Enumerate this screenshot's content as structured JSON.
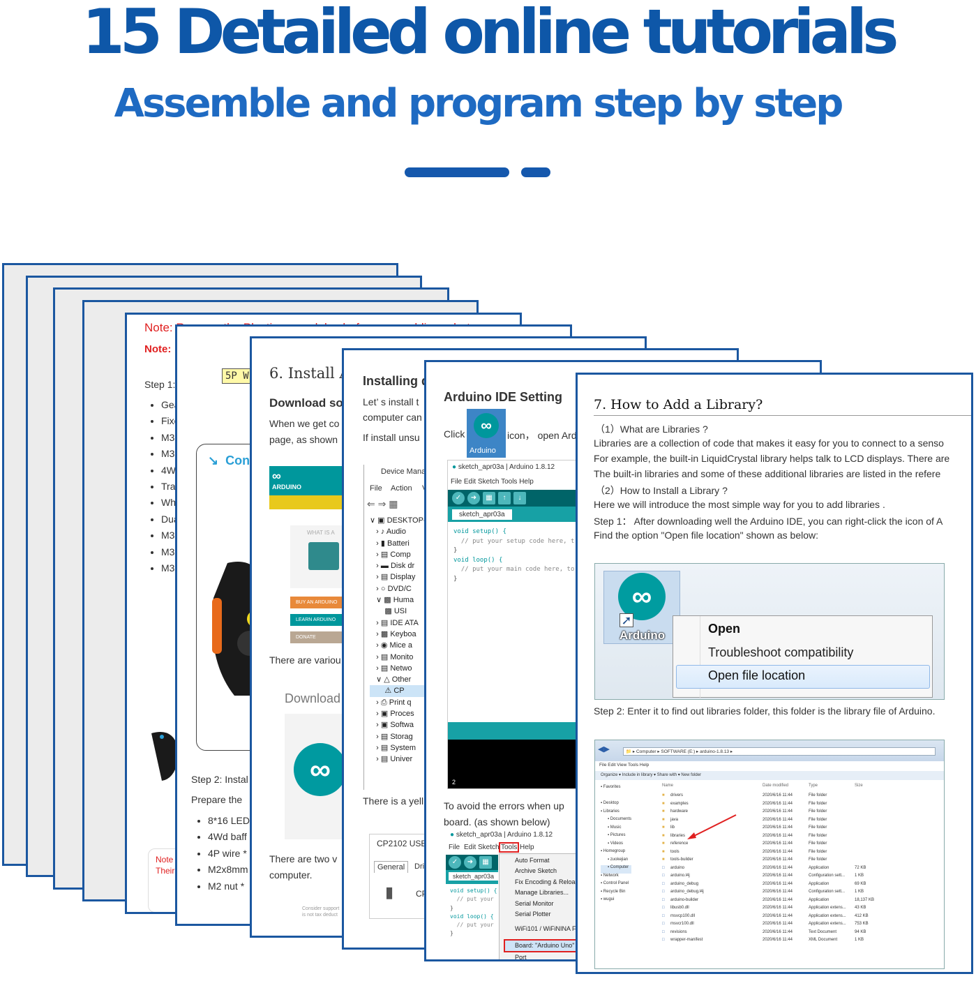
{
  "hero": {
    "title": "15 Detailed online tutorials",
    "subtitle": "Assemble and program step by step"
  },
  "pages": {
    "p1": {
      "note_red": "Note: Remove the Plastic ... modules before assembling robot ...",
      "note_label": "Note:",
      "step": "Step 1:",
      "items": [
        "Gea",
        "Fixe",
        "M3",
        "M3",
        "4W",
        "Trac",
        "Wh",
        "Dua",
        "M3",
        "M3",
        "M3"
      ],
      "bottom_note_1": "Note",
      "bottom_note_2": "Their"
    },
    "p2": {
      "label_5p": "5P Wi",
      "con": "Con",
      "step2": "Step 2: Instal",
      "prepare": "Prepare the",
      "items": [
        "8*16 LED",
        "4Wd baff",
        "4P wire *",
        "M2x8mm",
        "M2 nut *"
      ]
    },
    "p3": {
      "heading": "6. Install Ar",
      "subheading": "Download so",
      "line1": "When we get co",
      "line2": "page, as shown",
      "logo_text": "ARDUINO",
      "card_what": "WHAT IS A",
      "btn_buy": "BUY AN ARDUINO",
      "btn_learn": "LEARN ARDUINO",
      "btn_donate": "DONATE",
      "various": "There are variou",
      "download": "Download",
      "two": "There are two v",
      "computer": "computer.",
      "footer_1": "Consider support",
      "footer_2": "is not tax deduct"
    },
    "p4": {
      "heading": "Installing d",
      "line1": "Let’ s install t",
      "line2": "computer can",
      "line3": "If install unsu",
      "dm_title": "Device Mana",
      "dm_menu": [
        "File",
        "Action",
        "V"
      ],
      "tree": [
        "DESKTOP-",
        "Audio",
        "Batteri",
        "Comp",
        "Disk dr",
        "Display",
        "DVD/C",
        "Huma",
        "USI",
        "IDE ATA",
        "Keyboa",
        "Mice a",
        "Monito",
        "Netwo",
        "Other",
        "CP",
        "Print q",
        "Proces",
        "Softwa",
        "Storag",
        "System",
        "Univer"
      ],
      "yellow": "There is a yell",
      "cp_title": "CP2102 USB t",
      "tab_general": "General",
      "tab_driver": "Driv",
      "cp_short": "CP"
    },
    "p5": {
      "heading": "Arduino IDE Setting",
      "click": "Click",
      "icon_text": "icon， open Ard",
      "icon_label": "Arduino",
      "ide_title": "sketch_apr03a | Arduino 1.8.12",
      "ide_menu": "File  Edit  Sketch  Tools  Help",
      "tab": "sketch_apr03a",
      "code": [
        "void setup() {",
        "  // put your setup code here, t",
        "",
        "}",
        "",
        "void loop() {",
        "  // put your main code here, to",
        "",
        "}"
      ],
      "line_no": "2",
      "avoid_1": "To avoid the errors when up",
      "avoid_2": "board. (as shown below)",
      "ide2_title": "sketch_apr03a | Arduino 1.8.12",
      "ide2_menu": [
        "File",
        "Edit",
        "Sketch",
        "Tools",
        "Help"
      ],
      "ide2_tab": "sketch_apr03a",
      "ide2_code": [
        "void setup() {",
        "  // put your",
        "",
        "}",
        "",
        "void loop() {",
        "  // put your",
        "",
        "}"
      ],
      "tools_menu": [
        "Auto Format",
        "Archive Sketch",
        "Fix Encoding & Reload",
        "Manage Libraries...",
        "Serial Monitor",
        "Serial Plotter",
        "",
        "WiFi101 / WiFiNINA Fi",
        "",
        "Board: \"Arduino Uno\"",
        "Port"
      ]
    },
    "p6": {
      "heading": "7. How to Add a Library?",
      "q1": "（1）What are Libraries ?",
      "body1": "Libraries  are a collection of code that makes it easy for you to connect to a senso",
      "body2": "For example, the built-in LiquidCrystal library helps talk to LCD displays. There are",
      "body3": "The built-in libraries and some of these additional libraries are listed in the refere",
      "q2": "（2）How to Install a Library ?",
      "body4": "Here we will introduce the most simple way for you to add libraries .",
      "body5": "Step 1： After downloading well the Arduino IDE, you can right-click the icon of A",
      "body6": "Find the option \"Open file location\" shown as below:",
      "icon_label": "Arduino",
      "ctx_menu": [
        "Open",
        "Troubleshoot compatibility",
        "Open file location"
      ],
      "step2": "Step 2: Enter it to find out libraries folder, this folder is the library file of Arduino.",
      "exp_path": "▸ Computer ▸ SOFTWARE (E:) ▸ arduino-1.8.13 ▸",
      "exp_menu": "File   Edit   View   Tools   Help",
      "exp_toolbar": "Organize ▾      Include in library ▾      Share with ▾      New folder",
      "exp_headers": [
        "Name",
        "Date modified",
        "Type",
        "Size"
      ],
      "exp_nav": [
        "Favorites",
        "",
        "Desktop",
        "Libraries",
        "Documents",
        "Music",
        "Pictures",
        "Videos",
        "Homegroup",
        "zuokejian",
        "Computer",
        "Network",
        "Control Panel",
        "Recycle Bin",
        "wugui"
      ],
      "exp_files": [
        [
          "drivers",
          "2020/6/16 11:44",
          "File folder",
          ""
        ],
        [
          "examples",
          "2020/6/16 11:44",
          "File folder",
          ""
        ],
        [
          "hardware",
          "2020/6/16 11:44",
          "File folder",
          ""
        ],
        [
          "java",
          "2020/6/16 11:44",
          "File folder",
          ""
        ],
        [
          "lib",
          "2020/6/16 11:44",
          "File folder",
          ""
        ],
        [
          "libraries",
          "2020/6/16 11:44",
          "File folder",
          ""
        ],
        [
          "reference",
          "2020/6/16 11:44",
          "File folder",
          ""
        ],
        [
          "tools",
          "2020/6/16 11:44",
          "File folder",
          ""
        ],
        [
          "tools-builder",
          "2020/6/16 11:44",
          "File folder",
          ""
        ],
        [
          "arduino",
          "2020/6/16 11:44",
          "Application",
          "72 KB"
        ],
        [
          "arduino.l4j",
          "2020/6/16 11:44",
          "Configuration sett...",
          "1 KB"
        ],
        [
          "arduino_debug",
          "2020/6/16 11:44",
          "Application",
          "69 KB"
        ],
        [
          "arduino_debug.l4j",
          "2020/6/16 11:44",
          "Configuration sett...",
          "1 KB"
        ],
        [
          "arduino-builder",
          "2020/6/16 11:44",
          "Application",
          "18,137 KB"
        ],
        [
          "libusb0.dll",
          "2020/6/16 11:44",
          "Application extens...",
          "43 KB"
        ],
        [
          "msvcp100.dll",
          "2020/6/16 11:44",
          "Application extens...",
          "412 KB"
        ],
        [
          "msvcr100.dll",
          "2020/6/16 11:44",
          "Application extens...",
          "753 KB"
        ],
        [
          "revisions",
          "2020/6/16 11:44",
          "Text Document",
          "94 KB"
        ],
        [
          "wrapper-manifest",
          "2020/6/16 11:44",
          "XML Document",
          "1 KB"
        ]
      ]
    }
  },
  "colors": {
    "brand_blue": "#0e57a8",
    "sheet_border": "#1b57a0",
    "arduino_teal": "#00979c",
    "note_red": "#e02020",
    "ide_dark": "#006468"
  },
  "icons": [
    "arduino-logo-icon",
    "shortcut-arrow-icon",
    "folder-icon",
    "computer-icon",
    "red-arrow-icon"
  ]
}
